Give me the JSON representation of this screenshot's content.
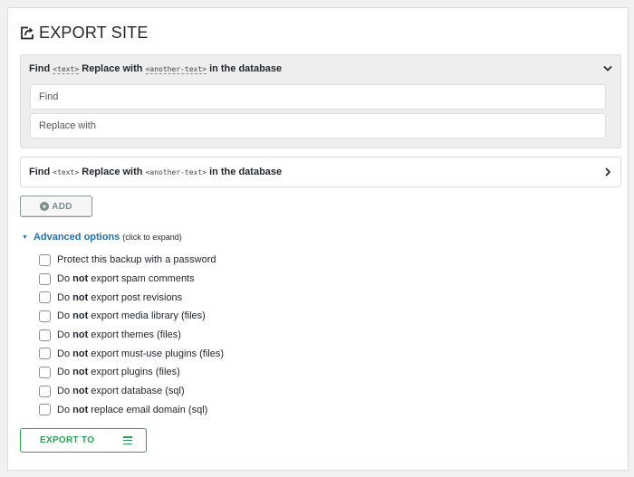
{
  "header": {
    "title": "EXPORT SITE",
    "icon": "share-export-icon"
  },
  "find_replace": [
    {
      "state": "expanded",
      "find_label": "Find",
      "text_code": "<text>",
      "replace_label": "Replace with",
      "another_code": "<another-text>",
      "suffix": "in the database",
      "find_placeholder": "Find",
      "replace_placeholder": "Replace with",
      "find_value": "",
      "replace_value": ""
    },
    {
      "state": "collapsed",
      "find_label": "Find",
      "text_code": "<text>",
      "replace_label": "Replace with",
      "another_code": "<another-text>",
      "suffix": "in the database"
    }
  ],
  "add_button": {
    "label": "ADD",
    "icon": "plus-circle-icon"
  },
  "advanced": {
    "label": "Advanced options",
    "hint": "(click to expand)",
    "arrow": "▼"
  },
  "options": [
    {
      "prefix": "Protect this backup with a password",
      "bold": "",
      "suffix": "",
      "checked": false
    },
    {
      "prefix": "Do",
      "bold": "not",
      "suffix": "export spam comments",
      "checked": false
    },
    {
      "prefix": "Do",
      "bold": "not",
      "suffix": "export post revisions",
      "checked": false
    },
    {
      "prefix": "Do",
      "bold": "not",
      "suffix": "export media library (files)",
      "checked": false
    },
    {
      "prefix": "Do",
      "bold": "not",
      "suffix": "export themes (files)",
      "checked": false
    },
    {
      "prefix": "Do",
      "bold": "not",
      "suffix": "export must-use plugins (files)",
      "checked": false
    },
    {
      "prefix": "Do",
      "bold": "not",
      "suffix": "export plugins (files)",
      "checked": false
    },
    {
      "prefix": "Do",
      "bold": "not",
      "suffix": "export database (sql)",
      "checked": false
    },
    {
      "prefix": "Do",
      "bold": "not",
      "suffix": "replace email domain (sql)",
      "checked": false
    }
  ],
  "export_button": {
    "label": "EXPORT TO",
    "icon": "menu-icon"
  },
  "colors": {
    "accent_blue": "#2271b1",
    "export_green": "#23a455",
    "add_gray": "#7b8a8b"
  }
}
